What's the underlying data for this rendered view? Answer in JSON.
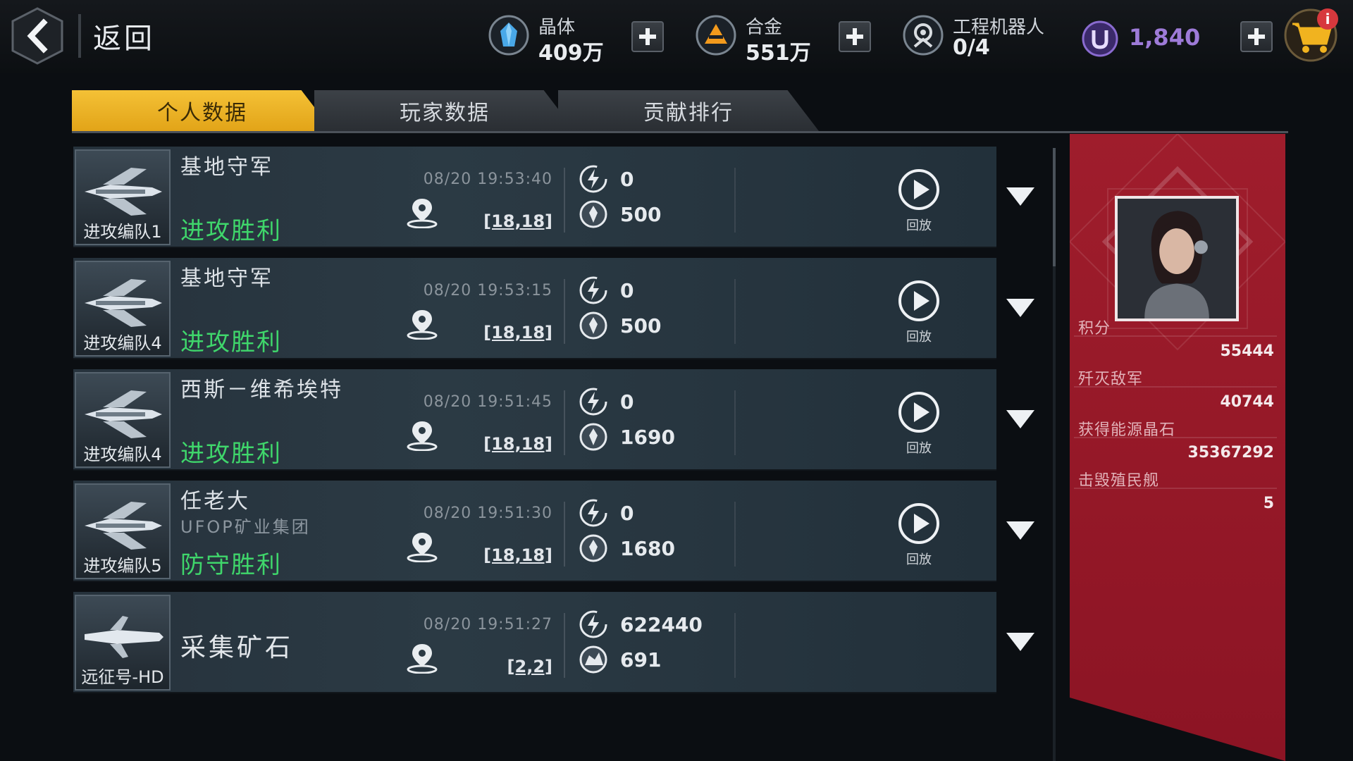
{
  "header": {
    "back_label": "返回",
    "crystal": {
      "label": "晶体",
      "value": "409万"
    },
    "alloy": {
      "label": "合金",
      "value": "551万"
    },
    "robot": {
      "label": "工程机器人",
      "value": "0/4"
    },
    "ucoin": {
      "value": "1,840"
    },
    "cart_badge": "i"
  },
  "tabs": [
    {
      "label": "个人数据",
      "active": true
    },
    {
      "label": "玩家数据",
      "active": false
    },
    {
      "label": "贡献排行",
      "active": false
    }
  ],
  "rows": [
    {
      "fleet": "进攻编队1",
      "name": "基地守军",
      "guild": "",
      "result": "进攻胜利",
      "time": "08/20 19:53:40",
      "coord": "[18,18]",
      "stat1": "0",
      "stat2": "500",
      "replay": "回放"
    },
    {
      "fleet": "进攻编队4",
      "name": "基地守军",
      "guild": "",
      "result": "进攻胜利",
      "time": "08/20 19:53:15",
      "coord": "[18,18]",
      "stat1": "0",
      "stat2": "500",
      "replay": "回放"
    },
    {
      "fleet": "进攻编队4",
      "name": "西斯－维希埃特",
      "guild": "",
      "result": "进攻胜利",
      "time": "08/20 19:51:45",
      "coord": "[18,18]",
      "stat1": "0",
      "stat2": "1690",
      "replay": "回放"
    },
    {
      "fleet": "进攻编队5",
      "name": "任老大",
      "guild": "UFOP矿业集团",
      "result": "防守胜利",
      "time": "08/20 19:51:30",
      "coord": "[18,18]",
      "stat1": "0",
      "stat2": "1680",
      "replay": "回放"
    },
    {
      "fleet": "远征号-HD",
      "name": "采集矿石",
      "guild": "",
      "result": "",
      "time": "08/20 19:51:27",
      "coord": "[2,2]",
      "stat1": "622440",
      "stat2": "691",
      "replay": ""
    }
  ],
  "panel": {
    "stats": [
      {
        "label": "积分",
        "value": "55444"
      },
      {
        "label": "歼灭敌军",
        "value": "40744"
      },
      {
        "label": "获得能源晶石",
        "value": "35367292"
      },
      {
        "label": "击毁殖民舰",
        "value": "5"
      }
    ]
  },
  "colors": {
    "accent_tab": "#f4c136",
    "win_green": "#3fd66b",
    "panel_red": "#9f1d2c",
    "ucoin_purple": "#9e7bd8"
  }
}
